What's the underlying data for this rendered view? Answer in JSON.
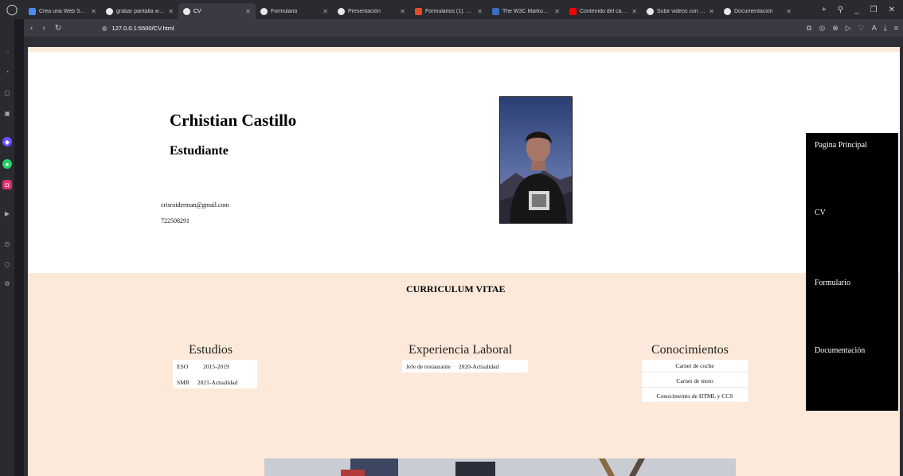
{
  "browser": {
    "tabs": [
      {
        "title": "Crea una Web Sencil",
        "favicon_color": "#4a8df0"
      },
      {
        "title": "grabar pantalla wind",
        "favicon_color": "#e9e9ee"
      },
      {
        "title": "CV",
        "favicon_color": "#e9e9ee",
        "active": true
      },
      {
        "title": "Formulario",
        "favicon_color": "#e9e9ee"
      },
      {
        "title": "Presentación",
        "favicon_color": "#e9e9ee"
      },
      {
        "title": "Formularios (1). HTM",
        "favicon_color": "#e44d26"
      },
      {
        "title": "The W3C Markup Va",
        "favicon_color": "#3a6fbd"
      },
      {
        "title": "Contenido del canal",
        "favicon_color": "#ff0000"
      },
      {
        "title": "Subir videos con una",
        "favicon_color": "#e9e9ee"
      },
      {
        "title": "Documentación",
        "favicon_color": "#e9e9ee"
      }
    ],
    "url": "127.0.0.1:5500/CV.html"
  },
  "cv": {
    "name": "Crhistian Castillo",
    "role": "Estudiante",
    "email": "crisroiderman@gmail.com",
    "phone": "722508291",
    "title": "CURRICULUM VITAE"
  },
  "nav": {
    "items": [
      "Pagina Principal",
      "CV",
      "Formulario",
      "Documentación"
    ]
  },
  "estudios": {
    "heading": "Estudios",
    "rows": [
      [
        "ESO",
        "2015-2019"
      ],
      [
        "SMR",
        "2021-Actualidad"
      ]
    ]
  },
  "experiencia": {
    "heading": "Experiencia Laboral",
    "rows": [
      [
        "Jefe de restaurante",
        "2020-Actualidad"
      ]
    ]
  },
  "conocimientos": {
    "heading": "Conocimientos",
    "items": [
      "Carnet de coche",
      "Carnet de moto",
      "Conocimeinto de HTML y CCS"
    ]
  },
  "colors": {
    "page_bg": "#fde9da",
    "nav_bg": "#000000",
    "browser_bg": "#2a2a31"
  }
}
